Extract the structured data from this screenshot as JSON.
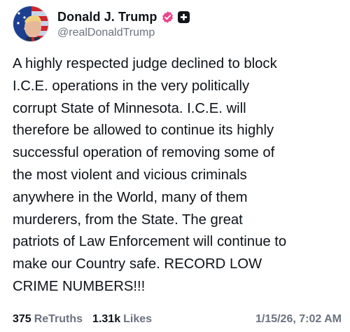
{
  "author": {
    "display_name": "Donald J. Trump",
    "handle": "@realDonaldTrump",
    "verified_badge_icon": "verified-check-icon",
    "verified_color": "#e8478b",
    "extra_badge_icon": "plus-square-icon"
  },
  "post": {
    "text": "A highly respected judge declined to block\nI.C.E. operations in the very politically\ncorrupt State of Minnesota. I.C.E. will\ntherefore be allowed to continue its highly\nsuccessful operation of removing some of\nthe most violent and vicious criminals\nanywhere in the World, many of them\nmurderers, from the State. The great\npatriots of Law Enforcement will continue to\nmake our Country safe. RECORD LOW\nCRIME NUMBERS!!!"
  },
  "stats": {
    "retruths_count": "375",
    "retruths_label": "ReTruths",
    "likes_count": "1.31k",
    "likes_label": "Likes",
    "timestamp": "1/15/26, 7:02 AM"
  }
}
